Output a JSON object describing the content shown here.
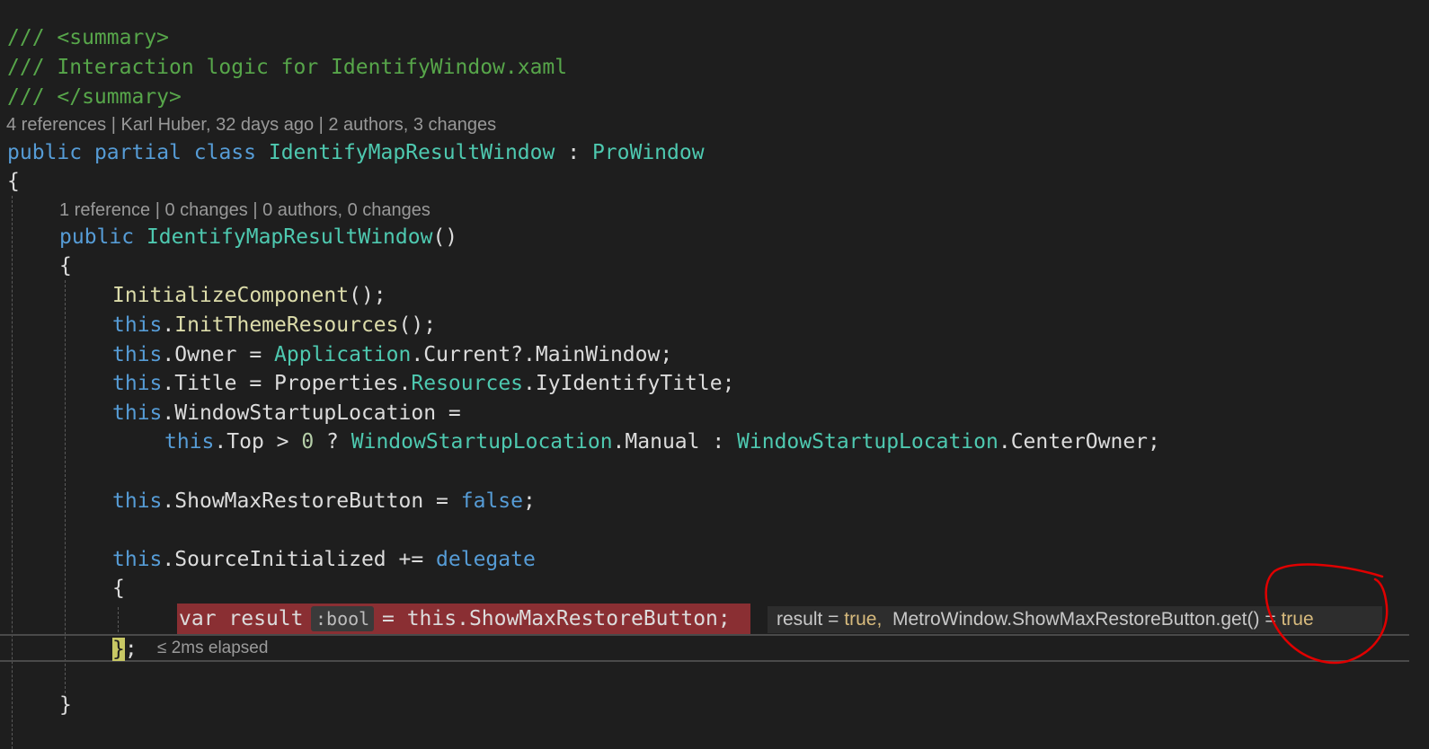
{
  "code": {
    "summary_open": "/// <summary>",
    "summary_text": "/// Interaction logic for IdentifyWindow.xaml",
    "summary_close": "/// </summary>",
    "class_lens": "4 references | Karl Huber, 32 days ago | 2 authors, 3 changes",
    "kw_public": "public",
    "kw_partial": "partial",
    "kw_class": "class",
    "class_name": "IdentifyMapResultWindow",
    "colon": ":",
    "base_class": "ProWindow",
    "open_brace": "{",
    "ctor_lens": "1 reference | 0 changes | 0 authors, 0 changes",
    "ctor_name": "IdentifyMapResultWindow",
    "parens": "()",
    "close_brace": "}",
    "l_init": "InitializeComponent",
    "call_end": "();",
    "kw_this": "this",
    "dot": ".",
    "l_inittheme": "InitThemeResources",
    "owner": "Owner",
    "assign": " = ",
    "application": "Application",
    "current_main": "Current?.MainWindow;",
    "title_prop": "Title",
    "properties": "Properties",
    "resources": "Resources",
    "iy_title": "IyIdentifyTitle;",
    "wsl_prop": "WindowStartupLocation",
    "assign_end": " =",
    "top": "Top",
    "gt": " > ",
    "zero": "0",
    "ternary_q": " ? ",
    "wsl_type": "WindowStartupLocation",
    "manual": "Manual",
    "ternary_c": " : ",
    "center_owner": "CenterOwner;",
    "show_max": "ShowMaxRestoreButton",
    "kw_false": "false",
    "semi": ";",
    "source_init": "SourceInitialized",
    "plus_eq": " += ",
    "kw_delegate": "delegate",
    "kw_var": "var",
    "result_var": "result",
    "type_hint": ":bool",
    "stmt_rest": "ShowMaxRestoreButton;",
    "brace_semi": ";"
  },
  "debugger": {
    "datatip_result": "result = ",
    "datatip_result_val": "true,",
    "datatip_getter": "MetroWindow.ShowMaxRestoreButton.get() = ",
    "datatip_getter_val": "true",
    "elapsed": "≤ 2ms elapsed"
  },
  "colors": {
    "keyword": "#569cd6",
    "type": "#4ec9b0",
    "method": "#dcdcaa",
    "comment": "#57a64a",
    "current_statement": "#8a2f33",
    "annotation": "#e00000"
  }
}
